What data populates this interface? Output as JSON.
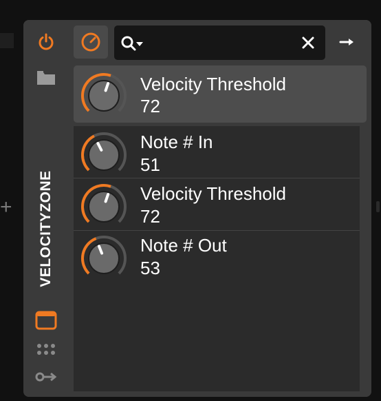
{
  "device": {
    "name": "VELOCITYZONE",
    "accent": "#f07a22"
  },
  "search": {
    "value": "",
    "placeholder": ""
  },
  "selected_param": {
    "name": "Velocity Threshold",
    "value": "72",
    "level": 0.57
  },
  "params": [
    {
      "name": "Note # In",
      "value": "51",
      "level": 0.4
    },
    {
      "name": "Velocity Threshold",
      "value": "72",
      "level": 0.57
    },
    {
      "name": "Note # Out",
      "value": "53",
      "level": 0.42
    }
  ],
  "icons": {
    "power": "power-icon",
    "folder": "folder-icon",
    "modulator": "modulator-icon",
    "search": "search-icon",
    "clear": "close-icon",
    "arrow": "arrow-right-icon",
    "window": "window-icon",
    "grid": "grid-dots-icon",
    "routing": "routing-icon"
  }
}
